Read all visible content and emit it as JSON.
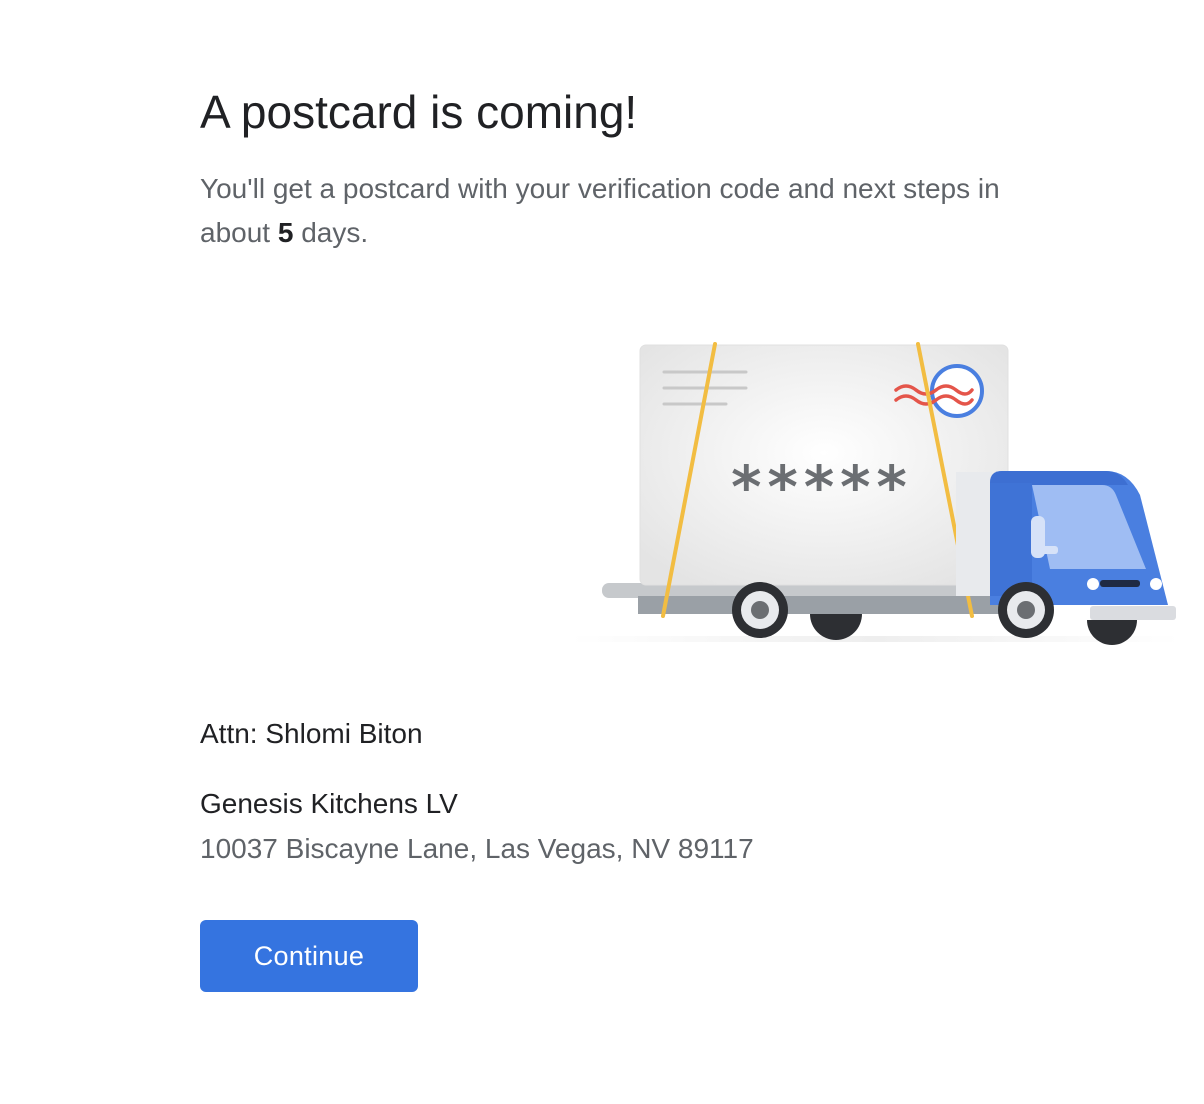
{
  "title": "A postcard is coming!",
  "description": {
    "before": "You'll get a postcard with your verification code and next steps in about ",
    "days": "5",
    "after": " days."
  },
  "illustration": {
    "code_mask": "*****"
  },
  "recipient": {
    "attn": "Attn: Shlomi Biton",
    "business_name": "Genesis Kitchens LV",
    "address": "10037 Biscayne Lane, Las Vegas, NV 89117"
  },
  "actions": {
    "continue_label": "Continue"
  },
  "colors": {
    "primary_button": "#3574e0",
    "title_text": "#202124",
    "secondary_text": "#5f6368",
    "truck_blue": "#4a7fe0",
    "strap_yellow": "#f2bd42",
    "stamp_red": "#e4554a"
  }
}
